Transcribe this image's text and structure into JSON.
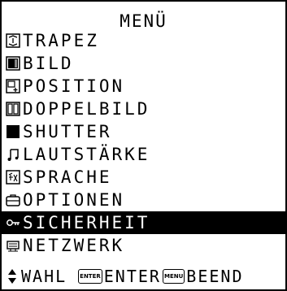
{
  "menu": {
    "title": "MENÜ",
    "selected_index": 8,
    "items": [
      {
        "label": "TRAPEZ",
        "icon": "trapezoid-icon"
      },
      {
        "label": "BILD",
        "icon": "picture-icon"
      },
      {
        "label": "POSITION",
        "icon": "position-icon"
      },
      {
        "label": "DOPPELBILD",
        "icon": "dual-picture-icon"
      },
      {
        "label": "SHUTTER",
        "icon": "shutter-icon"
      },
      {
        "label": "LAUTSTÄRKE",
        "icon": "music-note-icon"
      },
      {
        "label": "SPRACHE",
        "icon": "language-icon"
      },
      {
        "label": "OPTIONEN",
        "icon": "options-icon"
      },
      {
        "label": "SICHERHEIT",
        "icon": "key-icon"
      },
      {
        "label": "NETZWERK",
        "icon": "network-icon"
      }
    ]
  },
  "footer": {
    "select_label": "WAHL",
    "enter_key": "ENTER",
    "enter_label": "ENTER",
    "menu_key": "MENU",
    "exit_label": "BEEND"
  },
  "colors": {
    "background": "#ffffff",
    "foreground": "#000000",
    "highlight": "#000000"
  }
}
